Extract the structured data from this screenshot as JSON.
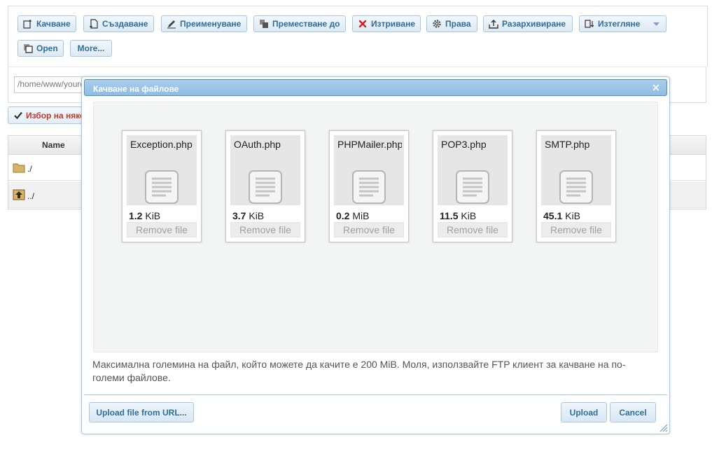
{
  "toolbar": {
    "upload_label": "Качване",
    "create_label": "Създаване",
    "rename_label": "Преименуване",
    "move_label": "Преместване до",
    "delete_label": "Изтриване",
    "permissions_label": "Права",
    "unarchive_label": "Разархивиране",
    "download_label": "Изтегляне",
    "open_label": "Open",
    "more_label": "More..."
  },
  "path": {
    "value": "/home/www/yourd"
  },
  "select_button": {
    "label": "Избор на някои"
  },
  "table": {
    "columns": [
      "Name"
    ],
    "rows": [
      {
        "name": "./",
        "icon": "folder-icon"
      },
      {
        "name": "../",
        "icon": "parent-folder-icon"
      }
    ]
  },
  "dialog": {
    "title": "Качване на файлове",
    "files": [
      {
        "name": "Exception.php",
        "size_value": "1.2",
        "size_unit": "KiB",
        "remove_label": "Remove file"
      },
      {
        "name": "OAuth.php",
        "size_value": "3.7",
        "size_unit": "KiB",
        "remove_label": "Remove file"
      },
      {
        "name": "PHPMailer.php",
        "size_value": "0.2",
        "size_unit": "MiB",
        "remove_label": "Remove file"
      },
      {
        "name": "POP3.php",
        "size_value": "11.5",
        "size_unit": "KiB",
        "remove_label": "Remove file"
      },
      {
        "name": "SMTP.php",
        "size_value": "45.1",
        "size_unit": "KiB",
        "remove_label": "Remove file"
      }
    ],
    "note": "Максимална големина на файл, който можете да качите е 200 MiB. Моля, използвайте FTP клиент за качване на по-големи файлове.",
    "upload_url_label": "Upload file from URL...",
    "upload_label": "Upload",
    "cancel_label": "Cancel"
  },
  "colors": {
    "accent": "#2e6e9e",
    "title_bar": "#97c2e6",
    "danger": "#c0392b"
  }
}
